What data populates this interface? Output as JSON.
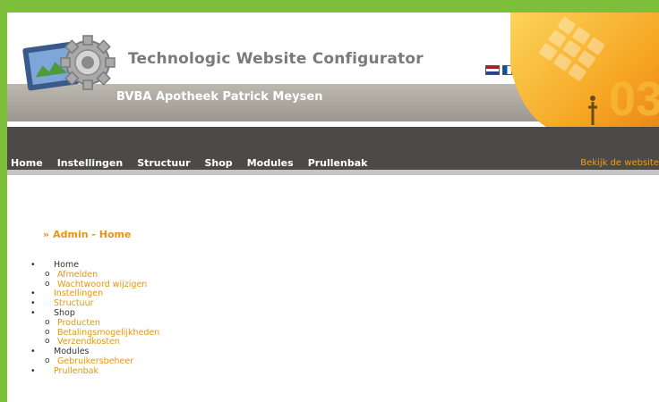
{
  "header": {
    "title": "Technologic Website Configurator",
    "subtitle": "BVBA Apotheek Patrick Meysen",
    "deco_number": "03"
  },
  "languages": [
    {
      "name": "nl-flag-icon"
    },
    {
      "name": "fr-flag-icon"
    }
  ],
  "nav": {
    "items": [
      "Home",
      "Instellingen",
      "Structuur",
      "Shop",
      "Modules",
      "Prullenbak"
    ],
    "view_site": "Bekijk de website"
  },
  "breadcrumb": {
    "arrow": "»",
    "text": "Admin - Home"
  },
  "menu": {
    "home": "Home",
    "afmelden": "Afmelden",
    "wachtwoord": "Wachtwoord wijzigen",
    "instellingen": "Instellingen",
    "structuur": "Structuur",
    "shop": "Shop",
    "producten": "Producten",
    "betaling": "Betalingsmogelijkheden",
    "verzend": "Verzendkosten",
    "modules": "Modules",
    "gebruikers": "Gebruikersbeheer",
    "prullenbak": "Prullenbak"
  },
  "colors": {
    "accent": "#e8960c",
    "frame": "#7dbf3a",
    "navbar": "#4c4a48"
  }
}
